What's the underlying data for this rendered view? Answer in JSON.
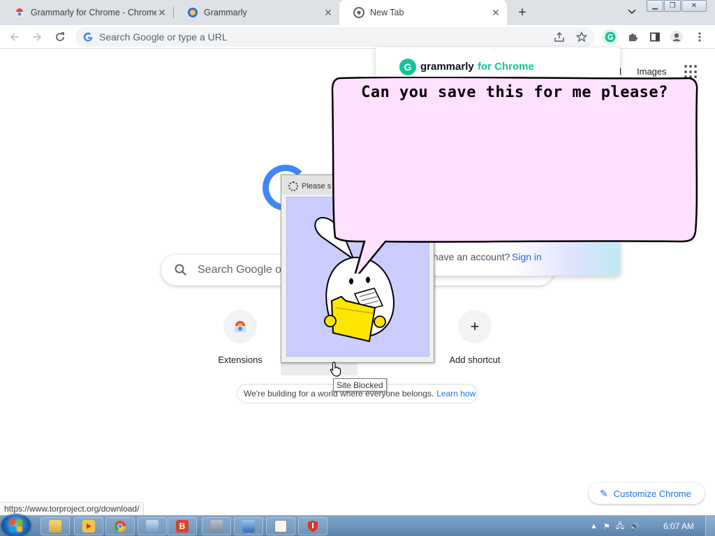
{
  "tabs": [
    {
      "title": "Grammarly for Chrome - Chrome",
      "close": "✕"
    },
    {
      "title": "Grammarly",
      "close": "✕"
    },
    {
      "title": "New Tab",
      "close": "✕"
    }
  ],
  "toolbar": {
    "omnibox_placeholder": "Search Google or type a URL"
  },
  "ntp": {
    "gmail_link": "ail",
    "images_link": "Images",
    "search_placeholder": "Search Google or",
    "shortcuts": [
      {
        "label": "Extensions"
      },
      {
        "label": "Add shortcut",
        "glyph": "+"
      }
    ],
    "banner_text": "We're building for a world where everyone belongs.",
    "banner_link": "Learn how",
    "customize_label": "Customize Chrome",
    "status_url": "https://www.torproject.org/download/"
  },
  "grammarly_popup": {
    "brand": "grammarly",
    "brand_sub": "for Chrome",
    "account_question": "have an account?",
    "sign_in": "Sign in"
  },
  "fake_window": {
    "title": "Please s",
    "tooltip": "Site Blocked"
  },
  "bubble": {
    "text": "Can you save this for me please?"
  },
  "taskbar": {
    "clock": "6:07 AM"
  },
  "colors": {
    "tab_strip": "#dee1e6",
    "link_blue": "#1a73e8",
    "grammarly_green": "#15c39a",
    "bubble_fill": "#ffe0ff",
    "bubble_picture_bg": "#ccccff",
    "folder_yellow": "#ffe600",
    "taskbar": "#6a92ba"
  }
}
